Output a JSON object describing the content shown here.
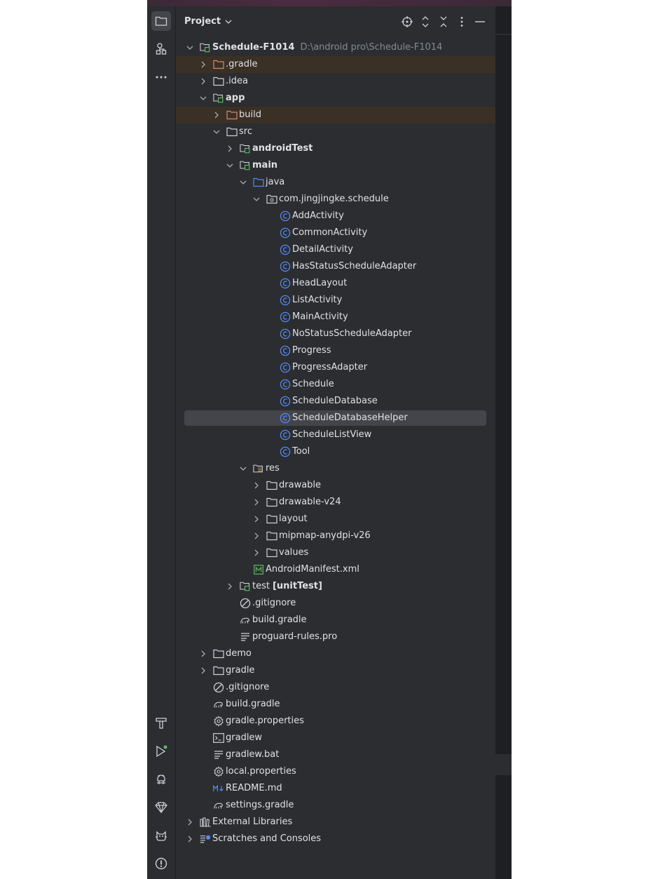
{
  "panel": {
    "title": "Project"
  },
  "colors": {
    "folder": "#ced0d6",
    "excluded_folder": "#d08b6e",
    "source_folder": "#548af7",
    "module_badge": "#5fb865",
    "class_icon": "#548af7",
    "ignored_row_bg": "#3a3025",
    "selected_row_bg": "#43454a"
  },
  "tree": [
    {
      "label": "Schedule-F1014",
      "hint": "D:\\android pro\\Schedule-F1014",
      "level": 0,
      "chevron": "down",
      "icon": "module-folder-icon",
      "bold": true
    },
    {
      "label": ".gradle",
      "level": 1,
      "chevron": "right",
      "icon": "excluded-folder-icon",
      "ignored": true
    },
    {
      "label": ".idea",
      "level": 1,
      "chevron": "right",
      "icon": "folder-icon"
    },
    {
      "label": "app",
      "level": 1,
      "chevron": "down",
      "icon": "module-folder-icon",
      "bold": true
    },
    {
      "label": "build",
      "level": 2,
      "chevron": "right",
      "icon": "excluded-folder-icon",
      "ignored": true
    },
    {
      "label": "src",
      "level": 2,
      "chevron": "down",
      "icon": "folder-icon"
    },
    {
      "label": "androidTest",
      "level": 3,
      "chevron": "right",
      "icon": "module-folder-icon",
      "bold": true
    },
    {
      "label": "main",
      "level": 3,
      "chevron": "down",
      "icon": "module-folder-icon",
      "bold": true
    },
    {
      "label": "java",
      "level": 4,
      "chevron": "down",
      "icon": "source-folder-icon"
    },
    {
      "label": "com.jingjingke.schedule",
      "level": 5,
      "chevron": "down",
      "icon": "package-icon"
    },
    {
      "label": "AddActivity",
      "level": 6,
      "icon": "class-icon"
    },
    {
      "label": "CommonActivity",
      "level": 6,
      "icon": "class-icon"
    },
    {
      "label": "DetailActivity",
      "level": 6,
      "icon": "class-icon"
    },
    {
      "label": "HasStatusScheduleAdapter",
      "level": 6,
      "icon": "class-icon"
    },
    {
      "label": "HeadLayout",
      "level": 6,
      "icon": "class-icon"
    },
    {
      "label": "ListActivity",
      "level": 6,
      "icon": "class-icon"
    },
    {
      "label": "MainActivity",
      "level": 6,
      "icon": "class-icon"
    },
    {
      "label": "NoStatusScheduleAdapter",
      "level": 6,
      "icon": "class-icon"
    },
    {
      "label": "Progress",
      "level": 6,
      "icon": "class-icon"
    },
    {
      "label": "ProgressAdapter",
      "level": 6,
      "icon": "class-icon"
    },
    {
      "label": "Schedule",
      "level": 6,
      "icon": "class-icon"
    },
    {
      "label": "ScheduleDatabase",
      "level": 6,
      "icon": "class-icon"
    },
    {
      "label": "ScheduleDatabaseHelper",
      "level": 6,
      "icon": "class-icon",
      "selected": true
    },
    {
      "label": "ScheduleListView",
      "level": 6,
      "icon": "class-icon"
    },
    {
      "label": "Tool",
      "level": 6,
      "icon": "class-icon"
    },
    {
      "label": "res",
      "level": 4,
      "chevron": "down",
      "icon": "resource-folder-icon"
    },
    {
      "label": "drawable",
      "level": 5,
      "chevron": "right",
      "icon": "folder-icon"
    },
    {
      "label": "drawable-v24",
      "level": 5,
      "chevron": "right",
      "icon": "folder-icon"
    },
    {
      "label": "layout",
      "level": 5,
      "chevron": "right",
      "icon": "folder-icon"
    },
    {
      "label": "mipmap-anydpi-v26",
      "level": 5,
      "chevron": "right",
      "icon": "folder-icon"
    },
    {
      "label": "values",
      "level": 5,
      "chevron": "right",
      "icon": "folder-icon"
    },
    {
      "label": "AndroidManifest.xml",
      "level": 4,
      "icon": "manifest-icon"
    },
    {
      "label": "test",
      "suffix": "[unitTest]",
      "level": 3,
      "chevron": "right",
      "icon": "module-folder-icon"
    },
    {
      "label": ".gitignore",
      "level": 3,
      "icon": "gitignore-icon"
    },
    {
      "label": "build.gradle",
      "level": 3,
      "icon": "gradle-icon"
    },
    {
      "label": "proguard-rules.pro",
      "level": 3,
      "icon": "text-file-icon"
    },
    {
      "label": "demo",
      "level": 1,
      "chevron": "right",
      "icon": "folder-icon"
    },
    {
      "label": "gradle",
      "level": 1,
      "chevron": "right",
      "icon": "folder-icon"
    },
    {
      "label": ".gitignore",
      "level": 1,
      "icon": "gitignore-icon"
    },
    {
      "label": "build.gradle",
      "level": 1,
      "icon": "gradle-icon"
    },
    {
      "label": "gradle.properties",
      "level": 1,
      "icon": "settings-file-icon"
    },
    {
      "label": "gradlew",
      "level": 1,
      "icon": "terminal-file-icon"
    },
    {
      "label": "gradlew.bat",
      "level": 1,
      "icon": "text-file-icon"
    },
    {
      "label": "local.properties",
      "level": 1,
      "icon": "settings-file-icon"
    },
    {
      "label": "README.md",
      "level": 1,
      "icon": "markdown-icon"
    },
    {
      "label": "settings.gradle",
      "level": 1,
      "icon": "gradle-icon"
    },
    {
      "label": "External Libraries",
      "level": 0,
      "chevron": "right",
      "icon": "library-icon"
    },
    {
      "label": "Scratches and Consoles",
      "level": 0,
      "chevron": "right",
      "icon": "scratches-icon"
    }
  ]
}
